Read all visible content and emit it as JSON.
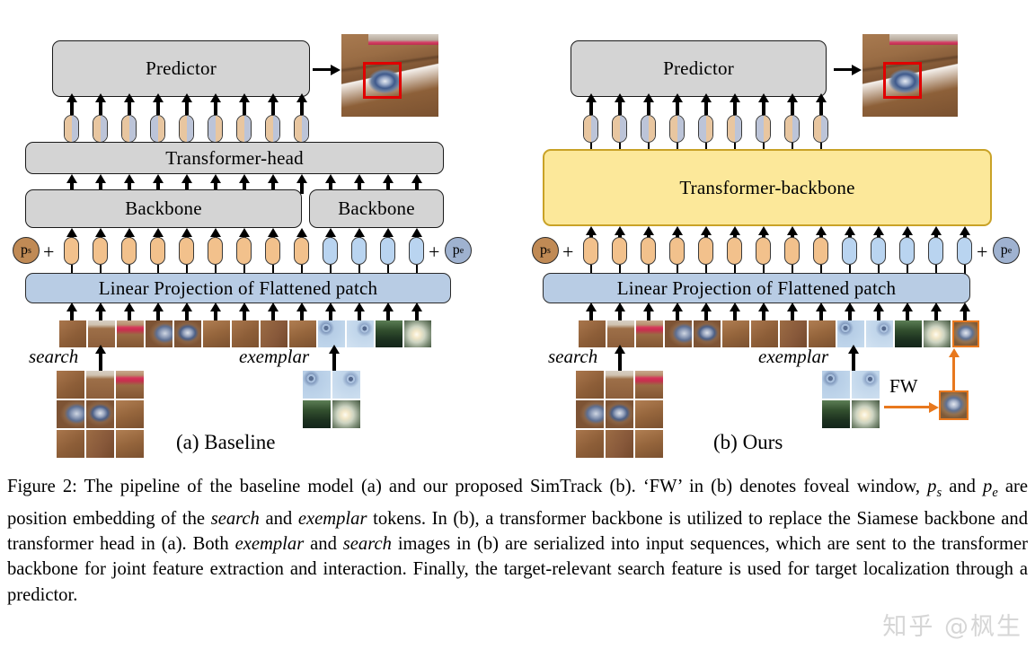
{
  "figure": {
    "panels": [
      {
        "id": "baseline",
        "label": "(a) Baseline",
        "predictor_label": "Predictor",
        "transformer_head_label": "Transformer-head",
        "backbone_search_label": "Backbone",
        "backbone_exemplar_label": "Backbone",
        "projection_label": "Linear Projection of Flattened patch",
        "ps_label": "p",
        "ps_sub": "s",
        "pe_label": "p",
        "pe_sub": "e",
        "plus_left": "+",
        "plus_right": "+",
        "search_label": "search",
        "exemplar_label": "exemplar",
        "search_token_count": 9,
        "exemplar_token_count": 4,
        "output_token_count": 9,
        "search_grid": "3x3",
        "exemplar_grid": "2x2"
      },
      {
        "id": "ours",
        "label": "(b) Ours",
        "predictor_label": "Predictor",
        "transformer_backbone_label": "Transformer-backbone",
        "projection_label": "Linear Projection of Flattened patch",
        "ps_label": "p",
        "ps_sub": "s",
        "pe_label": "p",
        "pe_sub": "e",
        "plus_left": "+",
        "plus_right": "+",
        "search_label": "search",
        "exemplar_label": "exemplar",
        "fw_label": "FW",
        "search_token_count": 9,
        "exemplar_token_count": 5,
        "output_token_count": 9,
        "search_grid": "3x3",
        "exemplar_grid": "2x2"
      }
    ],
    "colors": {
      "gray_box": "#d4d4d4",
      "blue_box": "#b8cce4",
      "yellow_box": "#fce89a",
      "yellow_border": "#c9a227",
      "search_token": "#f2c18c",
      "exemplar_token": "#b9d4f0",
      "ps_circle": "#c08a55",
      "pe_circle": "#9fb2d0",
      "fw_accent": "#e8781e",
      "bbox_red": "#e00000"
    }
  },
  "caption": {
    "prefix": "Figure 2:",
    "line1": " The pipeline of the baseline model (a) and our proposed SimTrack (b). ‘FW’ in (b) denotes foveal window, ",
    "ps": "p",
    "ps_sub": "s",
    "mid1": " and ",
    "pe": "p",
    "pe_sub": "e",
    "mid2": " are position embedding of the ",
    "search1": "search",
    "mid3": " and ",
    "exemplar1": "exemplar",
    "mid4": " tokens. In (b), a transformer backbone is utilized to replace the Siamese backbone and transformer head in (a). Both ",
    "exemplar2": "exemplar",
    "mid5": " and ",
    "search2": "search",
    "tail": " images in (b) are serialized into input sequences, which are sent to the transformer backbone for joint feature extraction and interaction. Finally, the target-relevant search feature is used for target localization through a predictor."
  },
  "watermark": {
    "text": "知乎 @枫生"
  }
}
